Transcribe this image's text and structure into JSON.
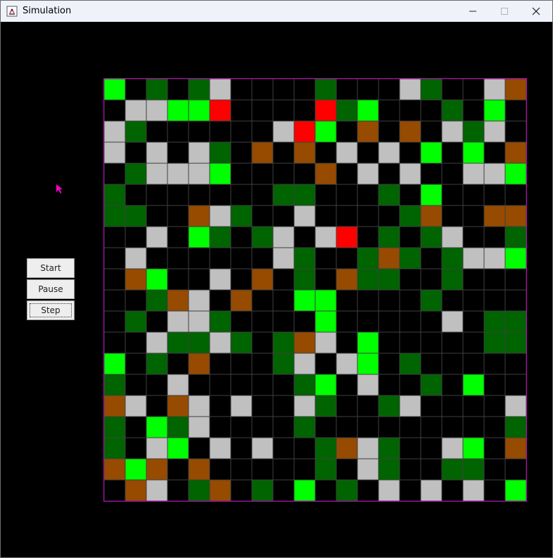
{
  "window": {
    "title": "Simulation"
  },
  "controls": {
    "start_label": "Start",
    "pause_label": "Pause",
    "step_label": "Step"
  },
  "icons": {
    "minimize": "minimize-icon",
    "maximize": "maximize-icon",
    "close": "close-icon",
    "app": "java-app-icon",
    "cursor": "mouse-pointer-icon"
  },
  "colors": {
    "K": "#000000",
    "G": "#00ff00",
    "D": "#006400",
    "W": "#c0c0c0",
    "B": "#964b00",
    "R": "#ff0000",
    "grid_line": "#404040",
    "grid_border": "#c000c0",
    "cursor": "#ff00c8"
  },
  "grid": {
    "rows": [
      "GKDKDWKKKKDKKKWDKKWB",
      "KWWGGRKKKKRDGKKKDKGK",
      "WDKKKKKKWRGKBKBKWDWK",
      "WKWKWDKBKBKWKWKGKGKB",
      "KDWWWGKKKKBKWKWKKWWG",
      "DKKKKKKKDDKKKDKGKKKK",
      "DDKKBWDKKWKKKKDBKKBB",
      "KKWKGDKDWKWRKDKDWKKD",
      "KWKKKKKKWDKKDBDKDWWG",
      "KBGKKWKBKDKBDDKKDKKK",
      "KKDBWKBKKGGKKKKDKKKK",
      "KDKWWDKKKKGKKKKKWKDD",
      "KKWDDWDKDBWKGKKKKKDD",
      "GKDKBKKKDWKWGKDKKKKK",
      "DKKWKKKKKDGKWKKDKGKK",
      "BWKBWKWKKWDKKDWKKKKW",
      "DKGDWKKKKDKKKKKKKKKD",
      "DKWGKWKWKKDBWDKKWGKB",
      "BGBKBKKKKKDKWDKKDDKK",
      "KBWKDBKDKGKDKWKWKWKG"
    ]
  }
}
